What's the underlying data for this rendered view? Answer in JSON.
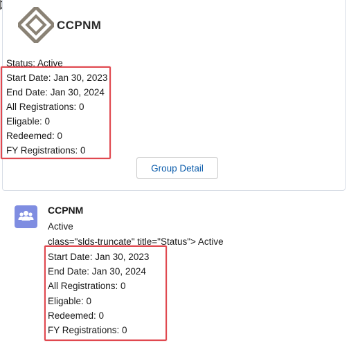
{
  "card": {
    "brand": "CCPNM",
    "status": "Status: Active",
    "start_date": "Start Date: Jan 30, 2023",
    "end_date": "End Date: Jan 30, 2024",
    "all_registrations": "All Registrations: 0",
    "eligable": "Eligable: 0",
    "redeemed": "Redeemed: 0",
    "fy_registrations": "FY Registrations: 0",
    "button_label": "Group Detail"
  },
  "group": {
    "title": "CCPNM",
    "status": "Active",
    "raw_markup": "class=\"slds-truncate\" title=\"Status\"> Active",
    "start_date": "Start Date: Jan 30, 2023",
    "end_date": "End Date: Jan 30, 2024",
    "all_registrations": "All Registrations: 0",
    "eligable": "Eligable: 0",
    "redeemed": "Redeemed: 0",
    "fy_registrations": "FY Registrations: 0",
    "icon": "group-icon"
  },
  "colors": {
    "highlight": "#e0484f",
    "link": "#0b5cab",
    "icon_bg": "#7f8de1",
    "logo": "#8a8275"
  }
}
